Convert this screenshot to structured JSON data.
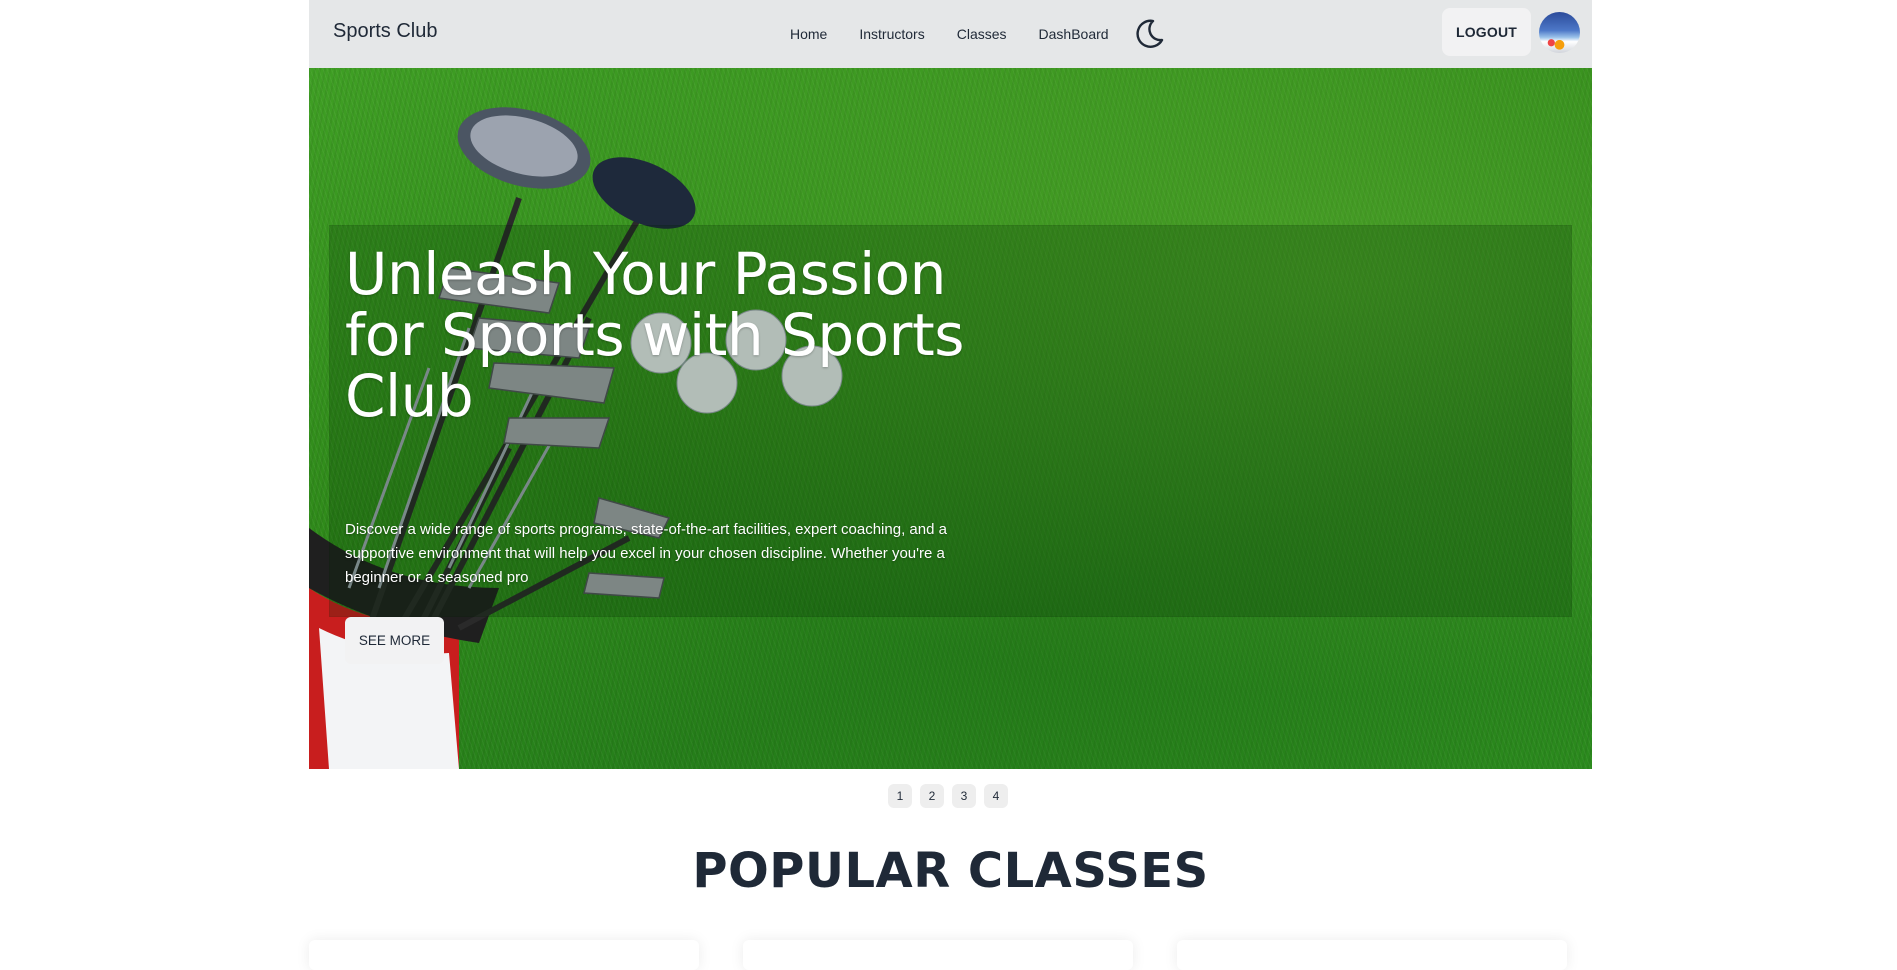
{
  "nav": {
    "brand": "Sports Club",
    "links": [
      "Home",
      "Instructors",
      "Classes",
      "DashBoard"
    ],
    "logout_label": "LOGOUT",
    "theme_icon": "moon-icon"
  },
  "hero": {
    "title": "Unleash Your Passion for Sports with Sports Club",
    "description": "Discover a wide range of sports programs, state-of-the-art facilities, expert coaching, and a supportive environment that will help you excel in your chosen discipline. Whether you're a beginner or a seasoned pro",
    "cta_label": "SEE MORE"
  },
  "carousel": {
    "pages": [
      "1",
      "2",
      "3",
      "4"
    ]
  },
  "popular": {
    "title": "POPULAR CLASSES"
  }
}
